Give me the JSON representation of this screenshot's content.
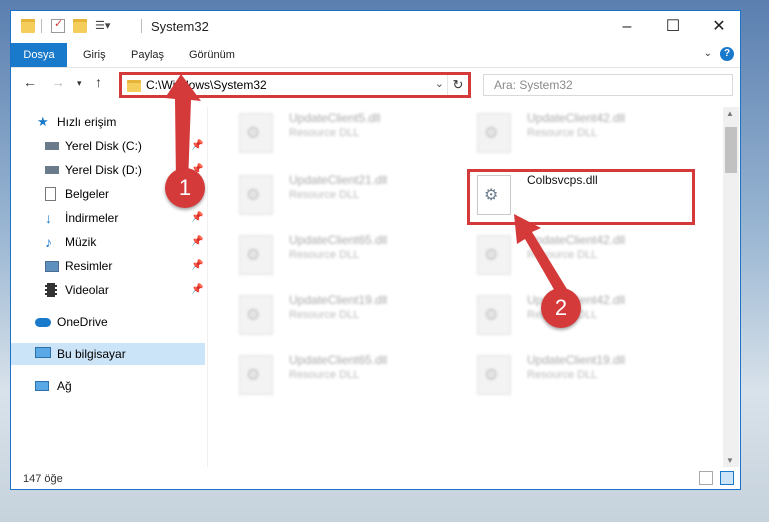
{
  "window": {
    "title": "System32"
  },
  "ribbon": {
    "tabs": [
      "Dosya",
      "Giriş",
      "Paylaş",
      "Görünüm"
    ]
  },
  "nav": {
    "path": "C:\\Windows\\System32",
    "search_placeholder": "Ara: System32"
  },
  "sidebar": {
    "items": [
      {
        "label": "Hızlı erişim",
        "icon": "star-icon"
      },
      {
        "label": "Yerel Disk (C:)",
        "icon": "drive-icon"
      },
      {
        "label": "Yerel Disk (D:)",
        "icon": "drive-icon"
      },
      {
        "label": "Belgeler",
        "icon": "documents-icon"
      },
      {
        "label": "İndirmeler",
        "icon": "download-icon"
      },
      {
        "label": "Müzik",
        "icon": "music-icon"
      },
      {
        "label": "Resimler",
        "icon": "pictures-icon"
      },
      {
        "label": "Videolar",
        "icon": "video-icon"
      },
      {
        "label": "OneDrive",
        "icon": "cloud-icon"
      },
      {
        "label": "Bu bilgisayar",
        "icon": "computer-icon"
      },
      {
        "label": "Ağ",
        "icon": "network-icon"
      }
    ]
  },
  "files": [
    {
      "name": "UpdateClient5.dll",
      "type": "Resource DLL"
    },
    {
      "name": "UpdateClient42.dll",
      "type": "Resource DLL"
    },
    {
      "name": "UpdateClient21.dll",
      "type": "Resource DLL"
    },
    {
      "name": "Colbsvcps.dll",
      "type": ""
    },
    {
      "name": "UpdateClient65.dll",
      "type": "Resource DLL"
    },
    {
      "name": "UpdateClient42.dll",
      "type": "Resource DLL"
    },
    {
      "name": "UpdateClient19.dll",
      "type": "Resource DLL"
    },
    {
      "name": "UpdateClient42.dll",
      "type": "Resource DLL"
    },
    {
      "name": "UpdateClient65.dll",
      "type": "Resource DLL"
    },
    {
      "name": "UpdateClient19.dll",
      "type": "Resource DLL"
    }
  ],
  "status": {
    "count": "147 öğe"
  },
  "annotations": {
    "step1": "1",
    "step2": "2",
    "color": "#d53a3a"
  }
}
